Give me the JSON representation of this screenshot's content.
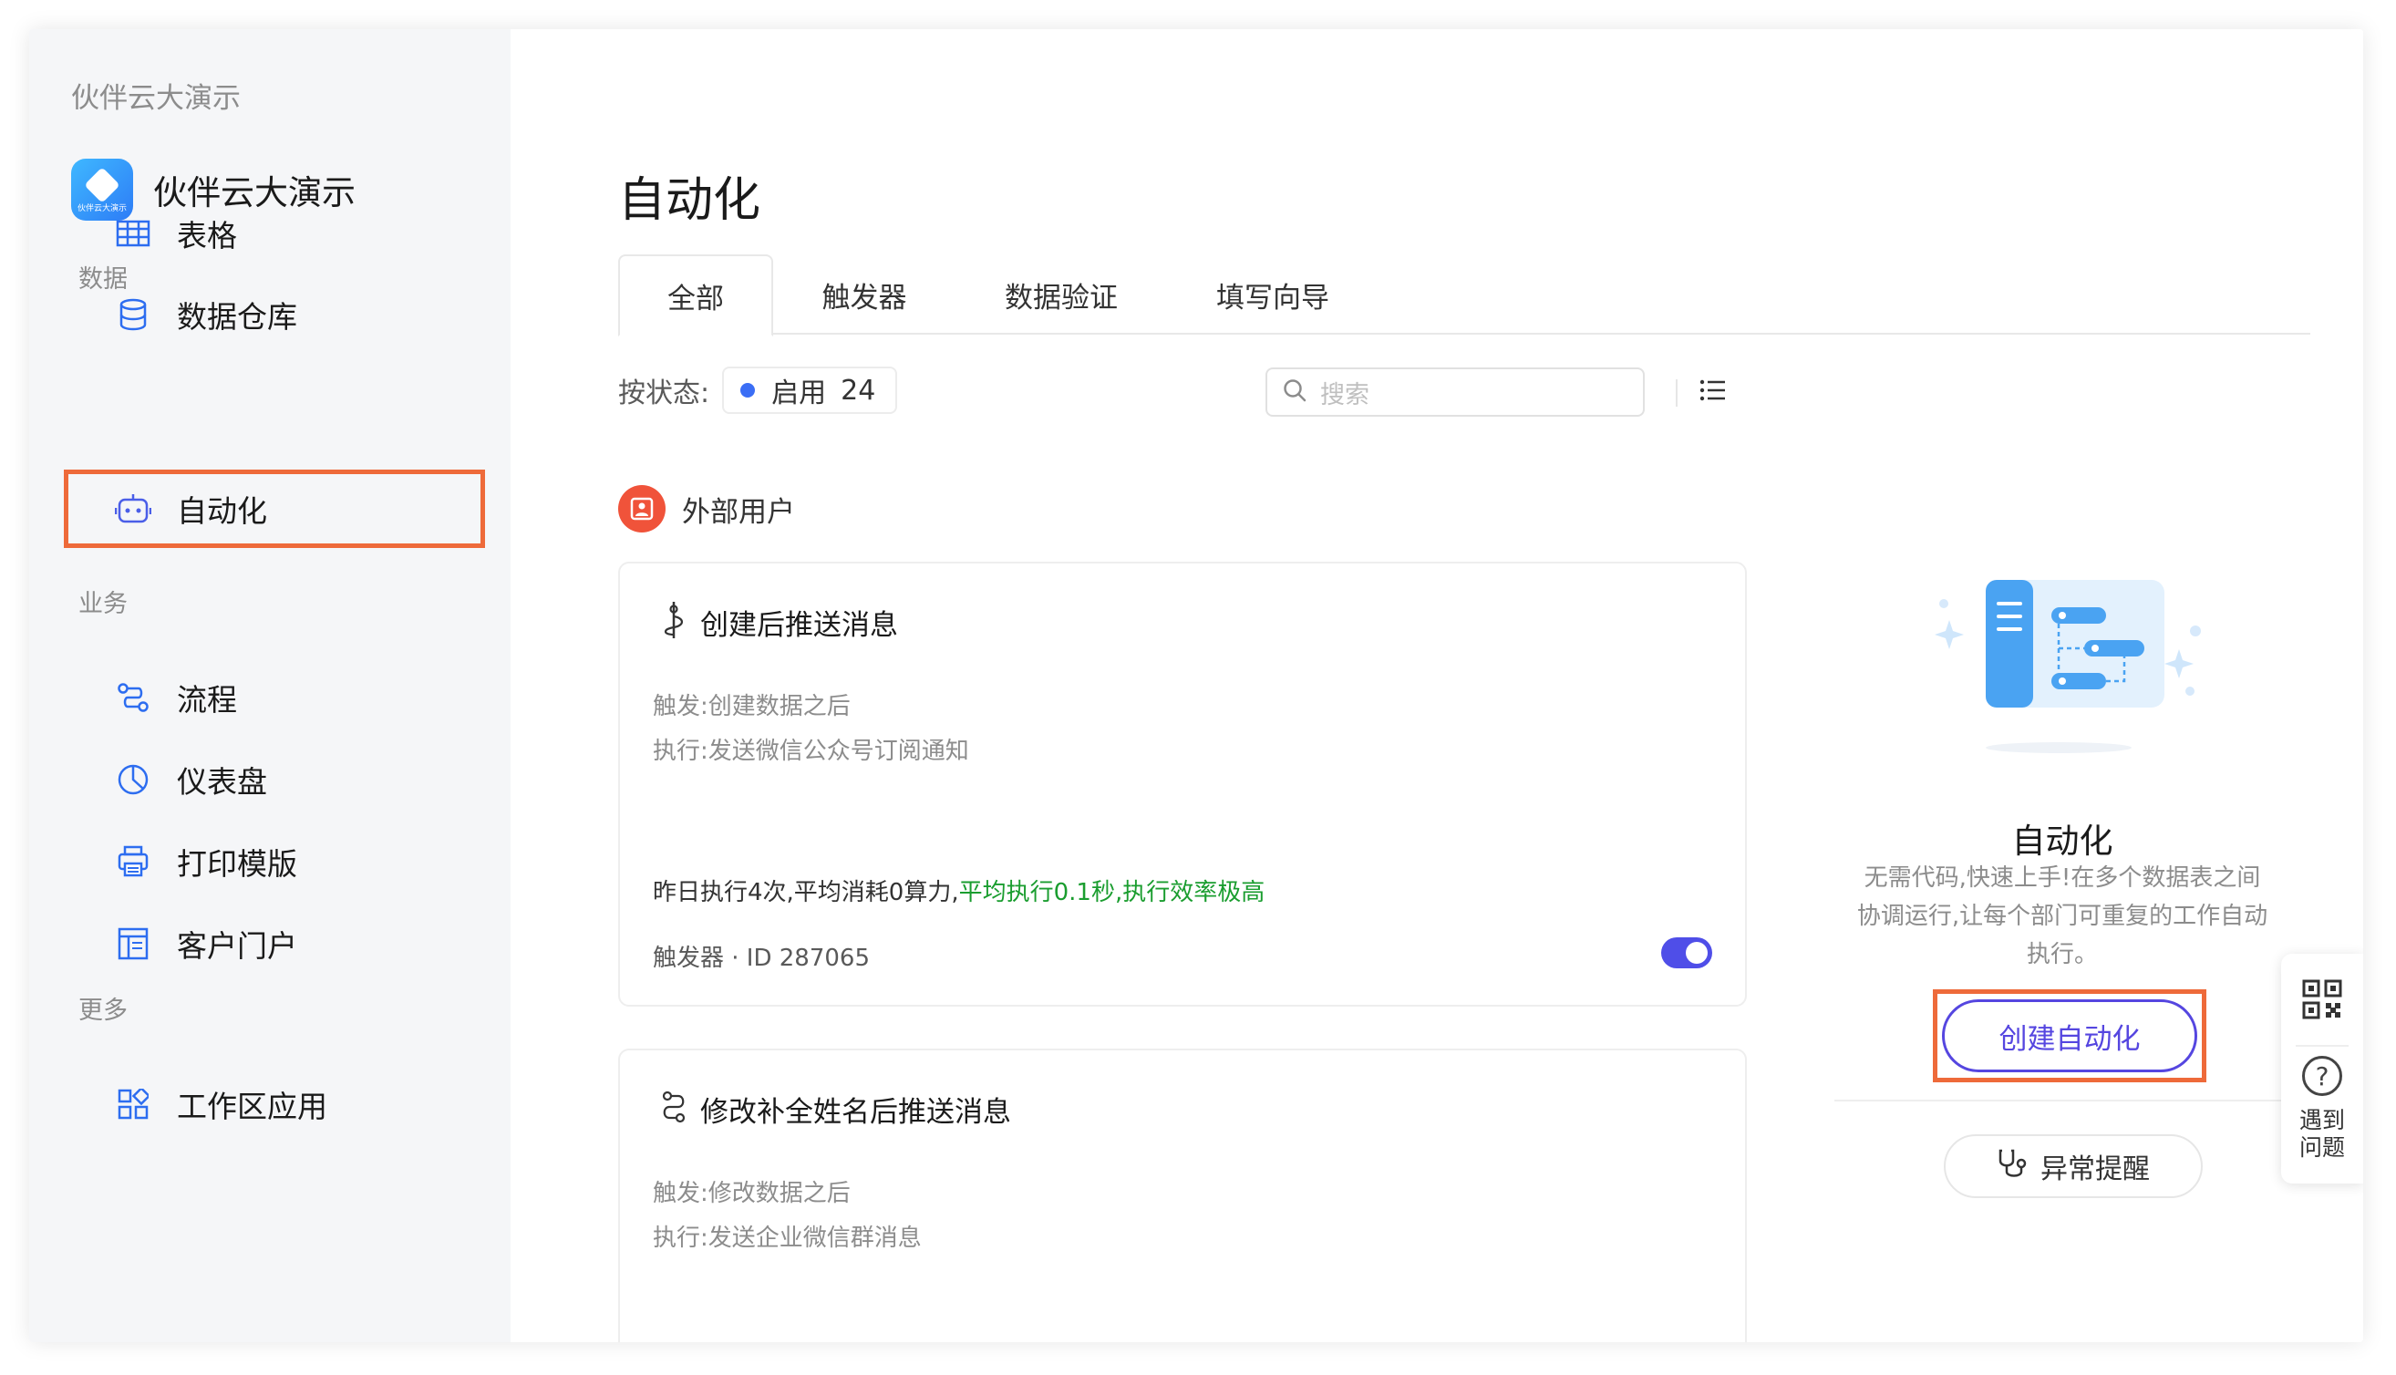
{
  "workspace": {
    "name": "伙伴云大演示"
  },
  "app": {
    "title": "伙伴云大演示",
    "logo_text": "伙伴云大演示"
  },
  "sidebar": {
    "sections": [
      {
        "label": "数据"
      },
      {
        "label": "业务"
      },
      {
        "label": "更多"
      }
    ],
    "items": [
      {
        "label": "表格",
        "icon": "table-icon"
      },
      {
        "label": "数据仓库",
        "icon": "database-icon"
      },
      {
        "label": "自动化",
        "icon": "robot-icon",
        "active": true
      },
      {
        "label": "流程",
        "icon": "flow-icon"
      },
      {
        "label": "仪表盘",
        "icon": "dashboard-icon"
      },
      {
        "label": "打印模版",
        "icon": "printer-icon"
      },
      {
        "label": "客户门户",
        "icon": "portal-icon"
      },
      {
        "label": "工作区应用",
        "icon": "apps-icon"
      }
    ]
  },
  "main": {
    "title": "自动化",
    "tabs": [
      {
        "label": "全部",
        "active": true
      },
      {
        "label": "触发器"
      },
      {
        "label": "数据验证"
      },
      {
        "label": "填写向导"
      }
    ],
    "filter": {
      "label": "按状态:",
      "status_text": "启用",
      "status_count": "24",
      "status_color": "#3b6ef5"
    },
    "search": {
      "placeholder": "搜索"
    },
    "group": {
      "name": "外部用户"
    },
    "cards": [
      {
        "title": "创建后推送消息",
        "trigger": "触发:创建数据之后",
        "action": "执行:发送微信公众号订阅通知",
        "stats_plain": "昨日执行4次,平均消耗0算力,",
        "stats_green": "平均执行0.1秒,执行效率极高",
        "footer": "触发器 · ID 287065",
        "enabled": true
      },
      {
        "title": "修改补全姓名后推送消息",
        "trigger": "触发:修改数据之后",
        "action": "执行:发送企业微信群消息"
      }
    ]
  },
  "right_panel": {
    "title": "自动化",
    "description": "无需代码,快速上手!在多个数据表之间协调运行,让每个部门可重复的工作自动执行。",
    "create_button": "创建自动化",
    "alert_button": "异常提醒",
    "accent_color": "#5546e0",
    "highlight_color": "#ee6a3a"
  },
  "float_help": {
    "text_line1": "遇到",
    "text_line2": "问题",
    "help_glyph": "?"
  }
}
